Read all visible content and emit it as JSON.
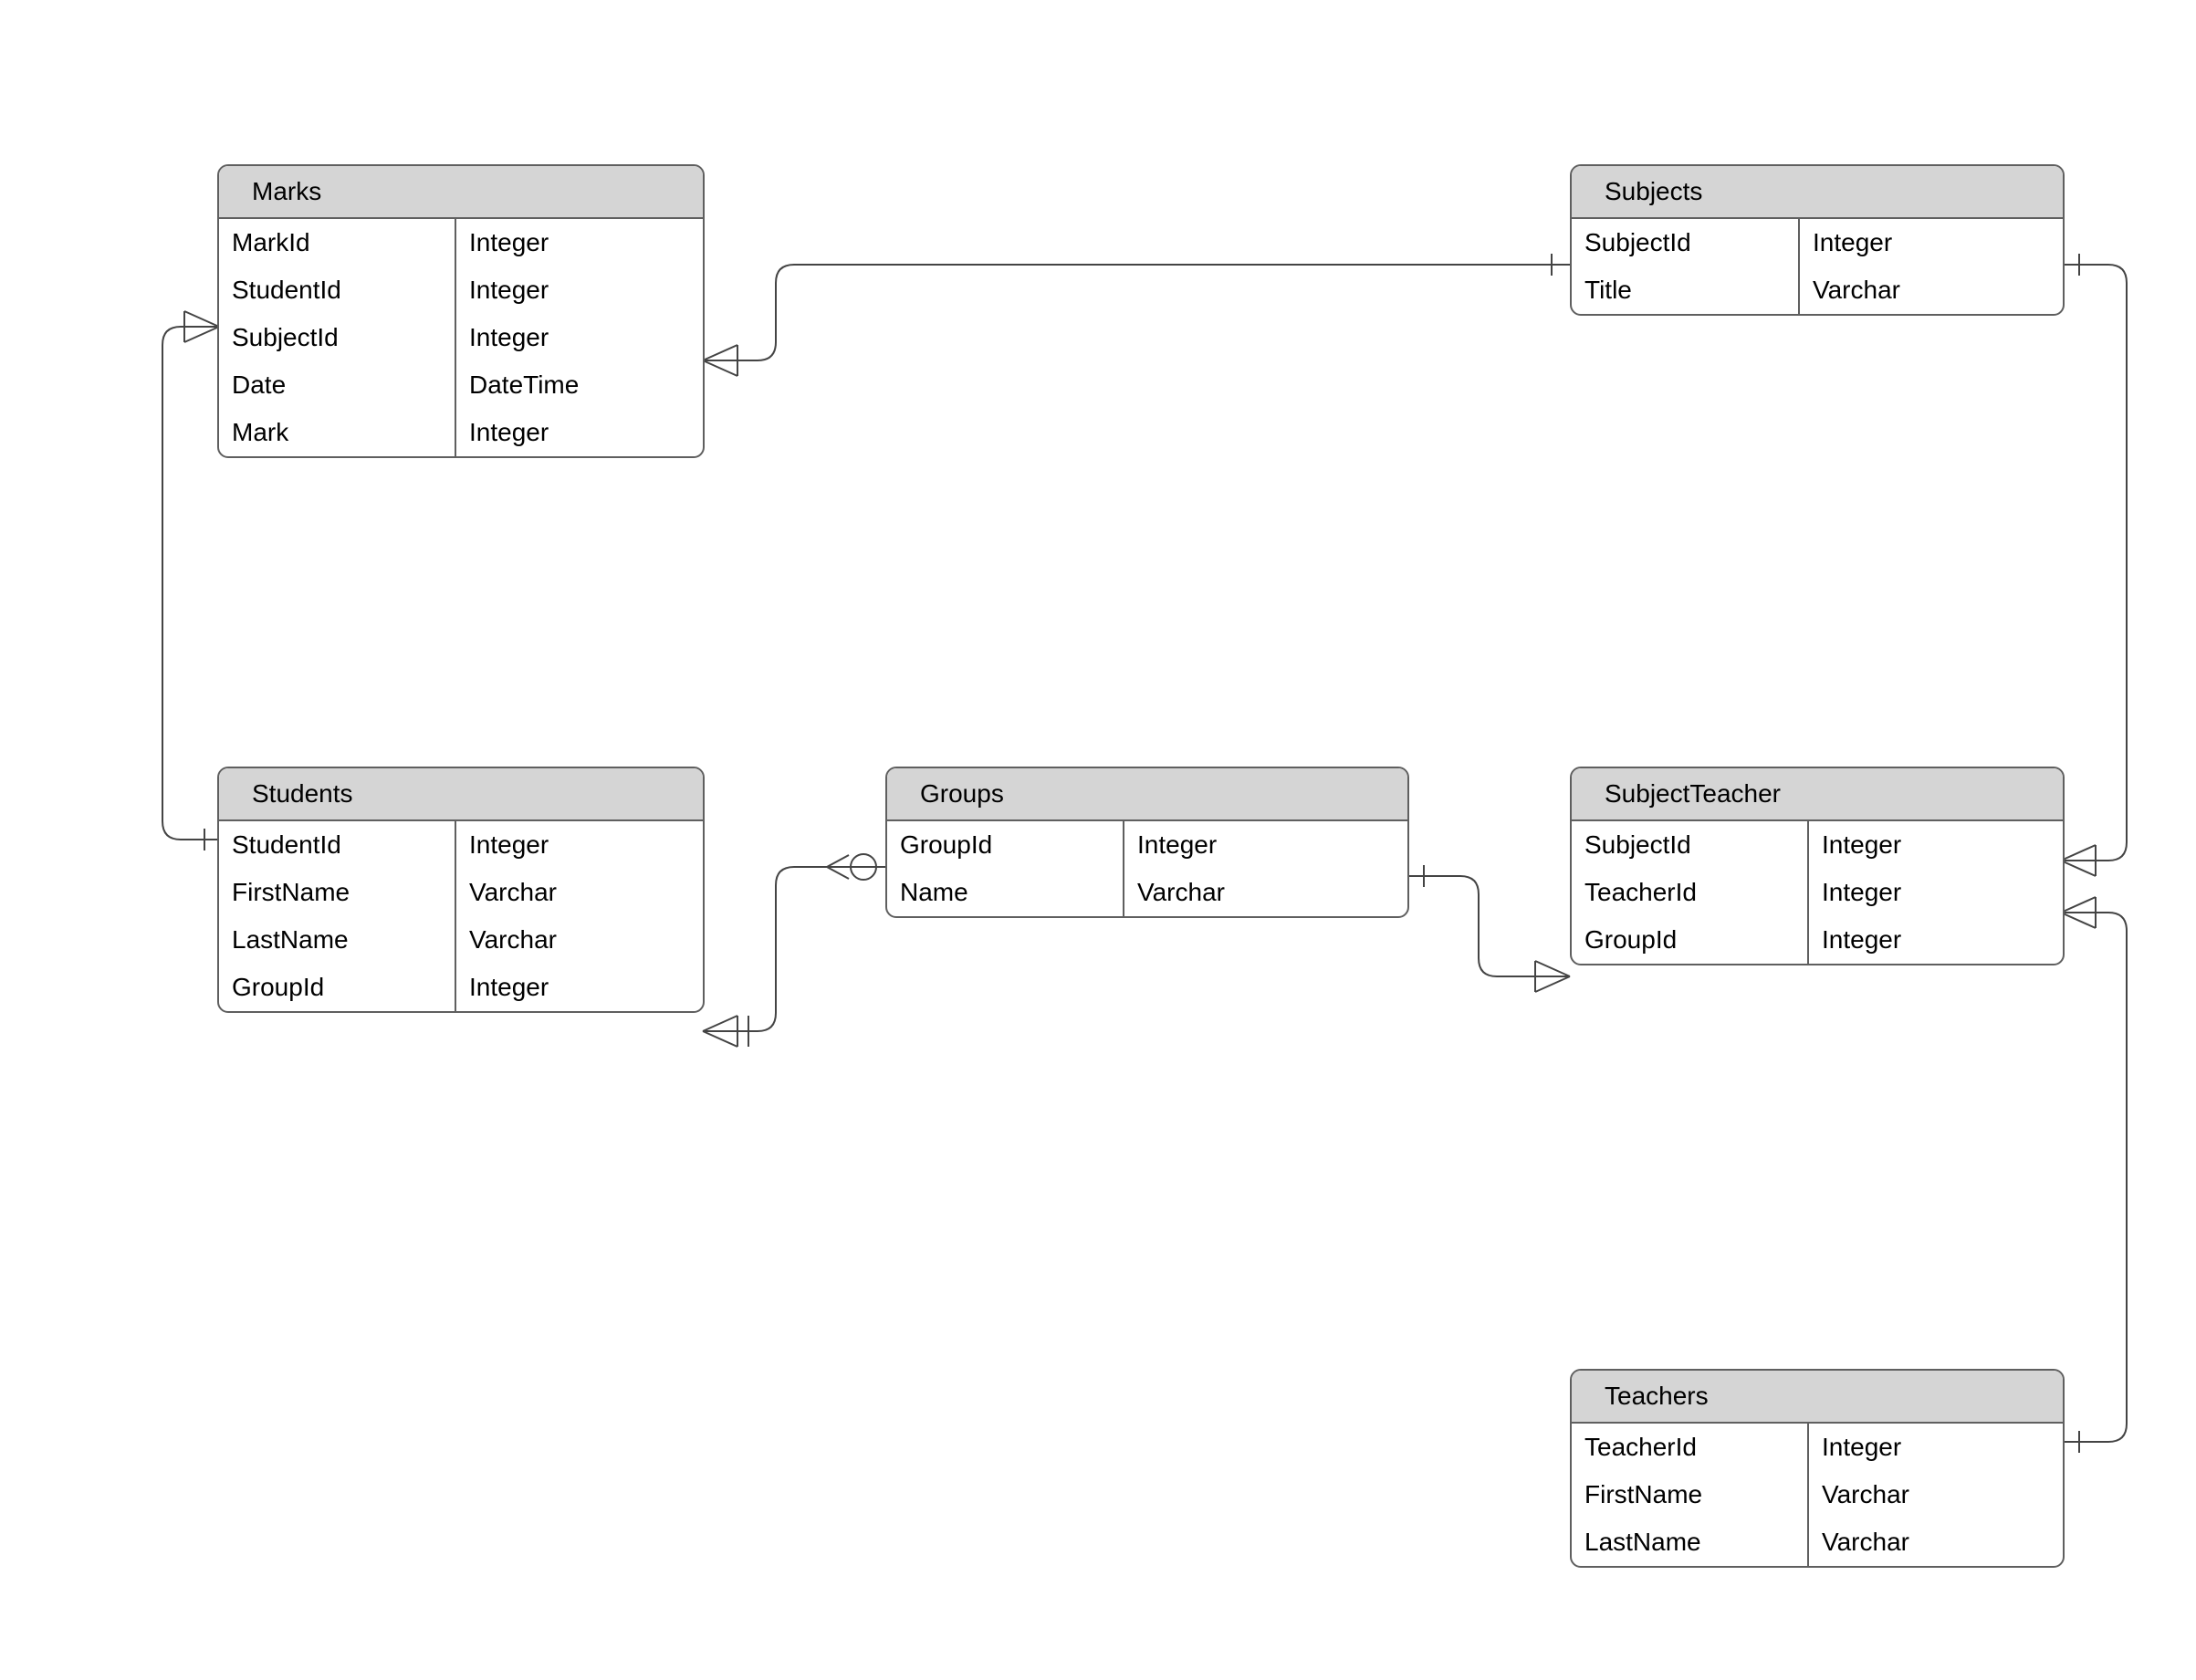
{
  "entities": {
    "marks": {
      "title": "Marks",
      "fields": [
        {
          "name": "MarkId",
          "type": "Integer"
        },
        {
          "name": "StudentId",
          "type": "Integer"
        },
        {
          "name": "SubjectId",
          "type": "Integer"
        },
        {
          "name": "Date",
          "type": "DateTime"
        },
        {
          "name": "Mark",
          "type": "Integer"
        }
      ]
    },
    "subjects": {
      "title": "Subjects",
      "fields": [
        {
          "name": "SubjectId",
          "type": "Integer"
        },
        {
          "name": "Title",
          "type": "Varchar"
        }
      ]
    },
    "students": {
      "title": "Students",
      "fields": [
        {
          "name": "StudentId",
          "type": "Integer"
        },
        {
          "name": "FirstName",
          "type": "Varchar"
        },
        {
          "name": "LastName",
          "type": "Varchar"
        },
        {
          "name": "GroupId",
          "type": "Integer"
        }
      ]
    },
    "groups": {
      "title": "Groups",
      "fields": [
        {
          "name": "GroupId",
          "type": "Integer"
        },
        {
          "name": "Name",
          "type": "Varchar"
        }
      ]
    },
    "subjectteacher": {
      "title": "SubjectTeacher",
      "fields": [
        {
          "name": "SubjectId",
          "type": "Integer"
        },
        {
          "name": "TeacherId",
          "type": "Integer"
        },
        {
          "name": "GroupId",
          "type": "Integer"
        }
      ]
    },
    "teachers": {
      "title": "Teachers",
      "fields": [
        {
          "name": "TeacherId",
          "type": "Integer"
        },
        {
          "name": "FirstName",
          "type": "Varchar"
        },
        {
          "name": "LastName",
          "type": "Varchar"
        }
      ]
    }
  },
  "relationships": [
    {
      "from": "Marks.SubjectId",
      "to": "Subjects.SubjectId",
      "type": "many-to-one"
    },
    {
      "from": "Marks.StudentId",
      "to": "Students.StudentId",
      "type": "many-to-one"
    },
    {
      "from": "Students.GroupId",
      "to": "Groups.GroupId",
      "type": "one-or-many-to-zero-or-one"
    },
    {
      "from": "SubjectTeacher.GroupId",
      "to": "Groups.GroupId",
      "type": "many-to-one"
    },
    {
      "from": "SubjectTeacher.SubjectId",
      "to": "Subjects.SubjectId",
      "type": "many-to-one"
    },
    {
      "from": "SubjectTeacher.TeacherId",
      "to": "Teachers.TeacherId",
      "type": "many-to-one"
    }
  ]
}
